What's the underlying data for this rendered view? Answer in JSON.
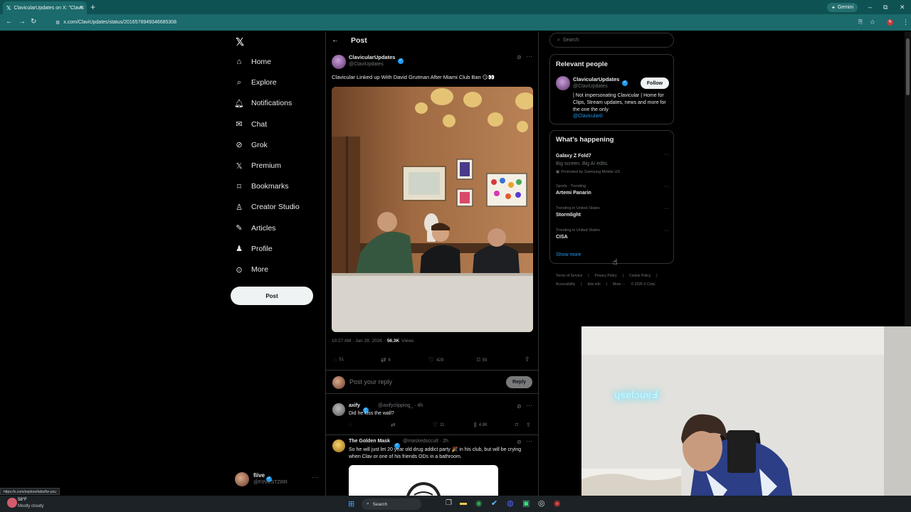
{
  "browser": {
    "tab_title": "ClavicularUpdates on X: \"Clavic",
    "url": "x.com/ClaviUpdates/status/2016578949346685308",
    "gemini_label": "Gemini",
    "profile_initial": "N",
    "accent": "#1b6a6c"
  },
  "nav": {
    "items": [
      {
        "label": "Home",
        "icon": "home-icon"
      },
      {
        "label": "Explore",
        "icon": "search-icon"
      },
      {
        "label": "Notifications",
        "icon": "bell-icon"
      },
      {
        "label": "Chat",
        "icon": "mail-icon"
      },
      {
        "label": "Grok",
        "icon": "grok-icon"
      },
      {
        "label": "Premium",
        "icon": "x-icon"
      },
      {
        "label": "Bookmarks",
        "icon": "bookmark-icon"
      },
      {
        "label": "Creator Studio",
        "icon": "creator-icon"
      },
      {
        "label": "Articles",
        "icon": "articles-icon"
      },
      {
        "label": "Profile",
        "icon": "person-icon"
      },
      {
        "label": "More",
        "icon": "more-circle-icon"
      }
    ],
    "post_button": "Post",
    "account": {
      "name": "fiive",
      "handle": "@FIIVESTZRR"
    }
  },
  "post": {
    "header": "Post",
    "author_name": "ClavicularUpdates",
    "author_handle": "@ClaviUpdates",
    "text": "Clavicular Linked up With David Grutman After Miami Club Ban 😏👀",
    "time": "10:27 AM · Jan 28, 2026 ·",
    "views_count": "56.3K",
    "views_label": "Views",
    "stats": {
      "replies": "51",
      "reposts": "6",
      "likes": "429",
      "bookmarks": "59"
    },
    "reply_placeholder": "Post your reply",
    "reply_button": "Reply"
  },
  "replies": [
    {
      "name": "axify",
      "handle": "@axifyclipping_ · 4h",
      "text": "Did he kiss the wall?",
      "likes": "11",
      "views": "4.8K"
    },
    {
      "name": "The Golden Mask",
      "handle": "@maskedoccult · 2h",
      "text": "So he will just let 20 year old drug addict party 🎉 in his club, but will be crying when Clav or one of his friends ODs in a bathroom."
    }
  ],
  "sidebar": {
    "search_placeholder": "Search",
    "relevant": {
      "title": "Relevant people",
      "name": "ClavicularUpdates",
      "handle": "@ClaviUpdates",
      "follow": "Follow",
      "bio": "| Not impersonating Clavicular | Home for Clips, Stream updates, news and more for the one the only",
      "bio_link": "@Clavicular0"
    },
    "happening": {
      "title": "What's happening",
      "trends": [
        {
          "context": "",
          "name": "Galaxy Z Fold7",
          "sub": "Big screen. Big AI edits.",
          "promo": "Promoted by Samsung Mobile US"
        },
        {
          "context": "Sports · Trending",
          "name": "Artemi Panarin"
        },
        {
          "context": "Trending in United States",
          "name": "Stormlight"
        },
        {
          "context": "Trending in United States",
          "name": "CISA"
        }
      ],
      "show_more": "Show more"
    },
    "footer": {
      "line1": [
        "Terms of Service",
        "Privacy Policy",
        "Cookie Policy"
      ],
      "line2": [
        "Accessibility",
        "Ads info",
        "More ···",
        "© 2026 X Corp."
      ]
    }
  },
  "webcam": {
    "sign": "ɥsɐlɔuɐℲ"
  },
  "status_url": "https://x.com/explore/tabs/for-you",
  "taskbar": {
    "weather_temp": "58°F",
    "weather_desc": "Mostly cloudy",
    "search": "Search"
  }
}
